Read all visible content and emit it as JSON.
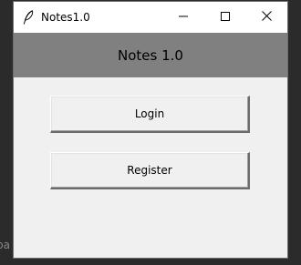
{
  "window": {
    "title": "Notes1.0",
    "app_icon": "feather-icon",
    "controls": [
      "minimize-icon",
      "maximize-icon",
      "close-icon"
    ]
  },
  "header": {
    "title": "Notes 1.0",
    "background": "#808080"
  },
  "buttons": {
    "login_label": "Login",
    "register_label": "Register"
  },
  "backdrop": {
    "partial_text": "ba"
  }
}
